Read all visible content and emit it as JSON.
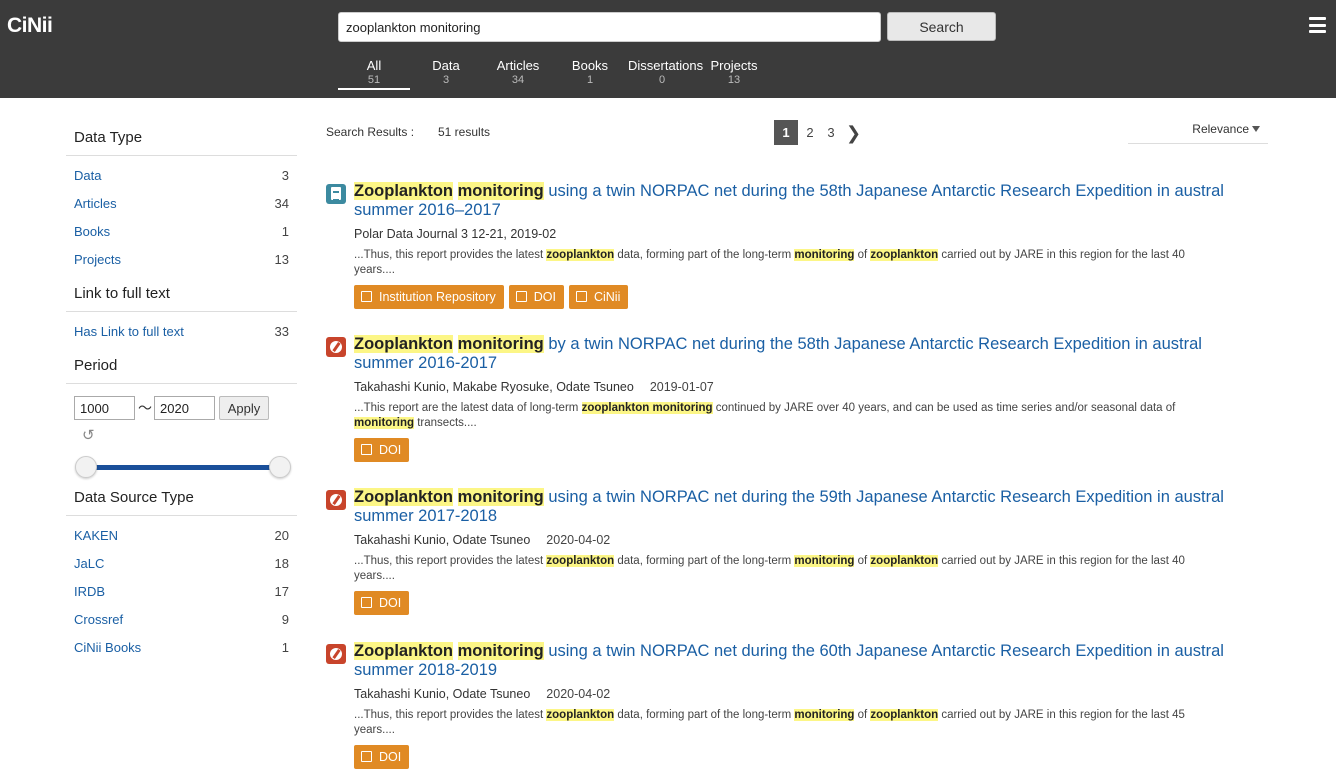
{
  "app": {
    "logo": "CiNii"
  },
  "search": {
    "value": "zooplankton monitoring",
    "button_label": "Search"
  },
  "tabs": [
    {
      "label": "All",
      "count": "51"
    },
    {
      "label": "Data",
      "count": "3"
    },
    {
      "label": "Articles",
      "count": "34"
    },
    {
      "label": "Books",
      "count": "1"
    },
    {
      "label": "Dissertations",
      "count": "0"
    },
    {
      "label": "Projects",
      "count": "13"
    }
  ],
  "sidebar": {
    "data_type": {
      "title": "Data Type",
      "items": [
        {
          "label": "Data",
          "count": "3"
        },
        {
          "label": "Articles",
          "count": "34"
        },
        {
          "label": "Books",
          "count": "1"
        },
        {
          "label": "Projects",
          "count": "13"
        }
      ]
    },
    "full_text": {
      "title": "Link to full text",
      "items": [
        {
          "label": "Has Link to full text",
          "count": "33"
        }
      ]
    },
    "period": {
      "title": "Period",
      "from": "1000",
      "tilde": "〜",
      "to": "2020",
      "apply_label": "Apply",
      "reset_symbol": "↺"
    },
    "data_source": {
      "title": "Data Source Type",
      "items": [
        {
          "label": "KAKEN",
          "count": "20"
        },
        {
          "label": "JaLC",
          "count": "18"
        },
        {
          "label": "IRDB",
          "count": "17"
        },
        {
          "label": "Crossref",
          "count": "9"
        },
        {
          "label": "CiNii Books",
          "count": "1"
        }
      ]
    }
  },
  "results_header": {
    "label": "Search Results :",
    "count": "51 results",
    "pages": [
      "1",
      "2",
      "3"
    ],
    "next_symbol": "❯",
    "sort_label": "Relevance"
  },
  "results": [
    {
      "type_icon": "data-icon",
      "title_parts": [
        {
          "text": "Zooplankton",
          "hl": true
        },
        {
          "text": " ",
          "hl": false
        },
        {
          "text": "monitoring",
          "hl": true
        },
        {
          "text": " using a twin NORPAC net during the 58th Japanese Antarctic Research Expedition in austral summer 2016–2017",
          "hl": false
        }
      ],
      "meta": "Polar Data Journal 3 12-21, 2019-02",
      "date": "",
      "snippet_parts": [
        {
          "text": "...Thus, this report provides the latest ",
          "hl": false
        },
        {
          "text": "zooplankton",
          "hl": true
        },
        {
          "text": " data, forming part of the long-term ",
          "hl": false
        },
        {
          "text": "monitoring",
          "hl": true
        },
        {
          "text": " of ",
          "hl": false
        },
        {
          "text": "zooplankton",
          "hl": true
        },
        {
          "text": " carried out by JARE in this region for the last 40 years....",
          "hl": false
        }
      ],
      "links": [
        "Institution Repository",
        "DOI",
        "CiNii"
      ]
    },
    {
      "type_icon": "article-icon",
      "title_parts": [
        {
          "text": "Zooplankton",
          "hl": true
        },
        {
          "text": " ",
          "hl": false
        },
        {
          "text": "monitoring",
          "hl": true
        },
        {
          "text": " by a twin NORPAC net during the 58th Japanese Antarctic Research Expedition in austral summer 2016-2017",
          "hl": false
        }
      ],
      "meta": "Takahashi Kunio, Makabe Ryosuke, Odate Tsuneo",
      "date": "2019-01-07",
      "snippet_parts": [
        {
          "text": "...This report are the latest data of long-term ",
          "hl": false
        },
        {
          "text": "zooplankton monitoring",
          "hl": true
        },
        {
          "text": " continued by JARE over 40 years, and can be used as time series and/or seasonal data of ",
          "hl": false
        },
        {
          "text": "monitoring",
          "hl": true
        },
        {
          "text": " transects....",
          "hl": false
        }
      ],
      "links": [
        "DOI"
      ]
    },
    {
      "type_icon": "article-icon",
      "title_parts": [
        {
          "text": "Zooplankton",
          "hl": true
        },
        {
          "text": " ",
          "hl": false
        },
        {
          "text": "monitoring",
          "hl": true
        },
        {
          "text": " using a twin NORPAC net during the 59th Japanese Antarctic Research Expedition in austral summer 2017-2018",
          "hl": false
        }
      ],
      "meta": "Takahashi Kunio, Odate Tsuneo",
      "date": "2020-04-02",
      "snippet_parts": [
        {
          "text": "...Thus, this report provides the latest ",
          "hl": false
        },
        {
          "text": "zooplankton",
          "hl": true
        },
        {
          "text": " data, forming part of the long-term ",
          "hl": false
        },
        {
          "text": "monitoring",
          "hl": true
        },
        {
          "text": " of ",
          "hl": false
        },
        {
          "text": "zooplankton",
          "hl": true
        },
        {
          "text": " carried out by JARE in this region for the last 40 years....",
          "hl": false
        }
      ],
      "links": [
        "DOI"
      ]
    },
    {
      "type_icon": "article-icon",
      "title_parts": [
        {
          "text": "Zooplankton",
          "hl": true
        },
        {
          "text": " ",
          "hl": false
        },
        {
          "text": "monitoring",
          "hl": true
        },
        {
          "text": " using a twin NORPAC net during the 60th Japanese Antarctic Research Expedition in austral summer 2018-2019",
          "hl": false
        }
      ],
      "meta": "Takahashi Kunio, Odate Tsuneo",
      "date": "2020-04-02",
      "snippet_parts": [
        {
          "text": "...Thus, this report provides the latest ",
          "hl": false
        },
        {
          "text": "zooplankton",
          "hl": true
        },
        {
          "text": " data, forming part of the long-term ",
          "hl": false
        },
        {
          "text": "monitoring",
          "hl": true
        },
        {
          "text": " of ",
          "hl": false
        },
        {
          "text": "zooplankton",
          "hl": true
        },
        {
          "text": " carried out by JARE in this region for the last 45 years....",
          "hl": false
        }
      ],
      "links": [
        "DOI"
      ]
    }
  ]
}
